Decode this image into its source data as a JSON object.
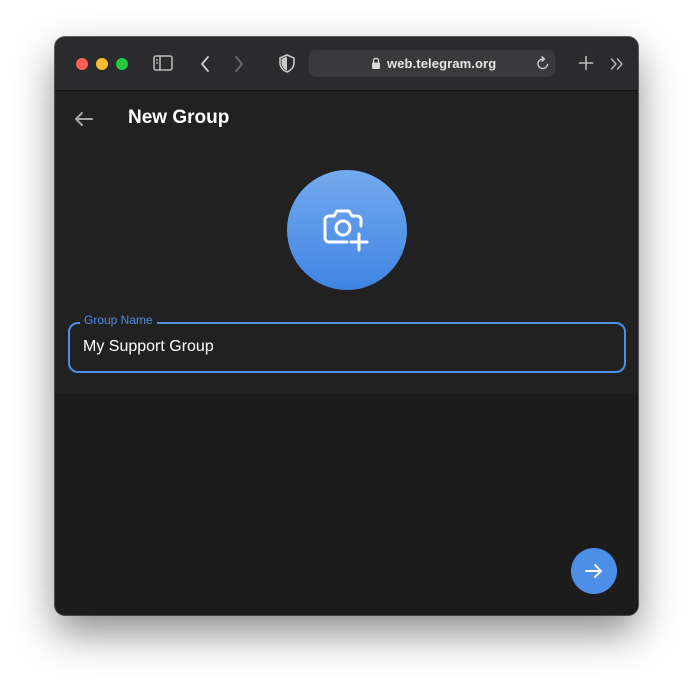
{
  "browser": {
    "url": "web.telegram.org",
    "icons": [
      "close-dot",
      "minimize-dot",
      "maximize-dot",
      "sidebar-toggle-icon",
      "back-chevron-icon",
      "forward-chevron-icon",
      "privacy-shield-icon",
      "lock-icon",
      "reload-icon",
      "new-tab-plus-icon",
      "more-chevron-icon"
    ]
  },
  "page": {
    "title": "New Group",
    "back_icon": "arrow-left-icon"
  },
  "group": {
    "avatar_icon": "camera-add-icon",
    "name_label": "Group Name",
    "name_value": "My Support Group"
  },
  "actions": {
    "next_icon": "arrow-right-icon"
  },
  "colors": {
    "accent": "#4d8ee6",
    "avatar_gradient_top": "#74aaef",
    "avatar_gradient_bottom": "#3f84e3",
    "panel_bg": "#212121",
    "page_bg": "#1c1c1c"
  }
}
